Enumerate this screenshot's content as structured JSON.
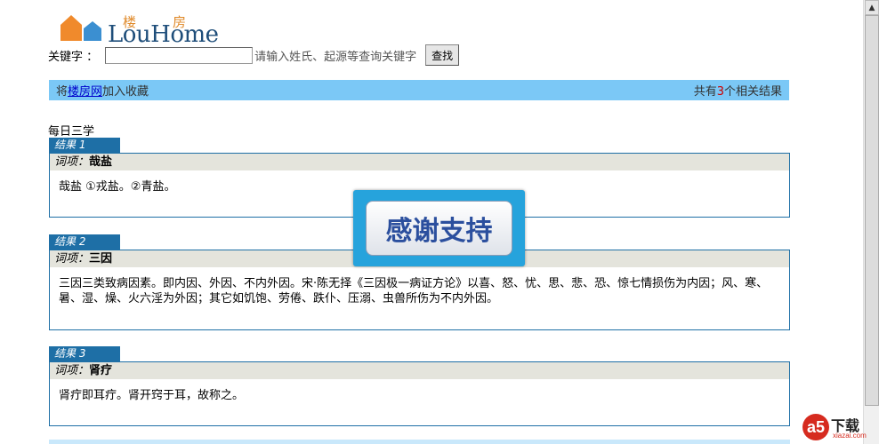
{
  "logo": {
    "cn_left": "楼",
    "cn_right": "房",
    "en": "LouHome"
  },
  "search": {
    "label": "关键字 ：",
    "input_value": "",
    "hint": "请输入姓氏、起源等查询关键字",
    "button_label": "查找"
  },
  "infobar": {
    "prefix": "将",
    "link_text": "楼房网",
    "suffix": "加入收藏",
    "count_prefix": "共有",
    "count": "3",
    "count_suffix": "个相关结果"
  },
  "section_title": "每日三学",
  "results": [
    {
      "tab": "结果 1",
      "head_prefix": "词项：",
      "term": "哉盐",
      "body": "哉盐 ①戎盐。②青盐。"
    },
    {
      "tab": "结果 2",
      "head_prefix": "词项：",
      "term": "三因",
      "body": "三因三类致病因素。即内因、外因、不内外因。宋·陈无择《三因极一病证方论》以喜、怒、忧、思、悲、恐、惊七情损伤为内因；风、寒、暑、湿、燥、火六淫为外因；其它如饥饱、劳倦、跌仆、压溺、虫兽所伤为不内外因。"
    },
    {
      "tab": "结果 3",
      "head_prefix": "词项：",
      "term": "肾疗",
      "body": "肾疔即耳疔。肾开窍于耳，故称之。"
    }
  ],
  "overlay": {
    "text": "感谢支持"
  },
  "watermark": {
    "logo": "a5",
    "text": "下载",
    "sub": "xiazai.com"
  },
  "colors": {
    "infobar": "#7bc8f6",
    "tab": "#1e6fa6",
    "head": "#e4e4dc"
  }
}
